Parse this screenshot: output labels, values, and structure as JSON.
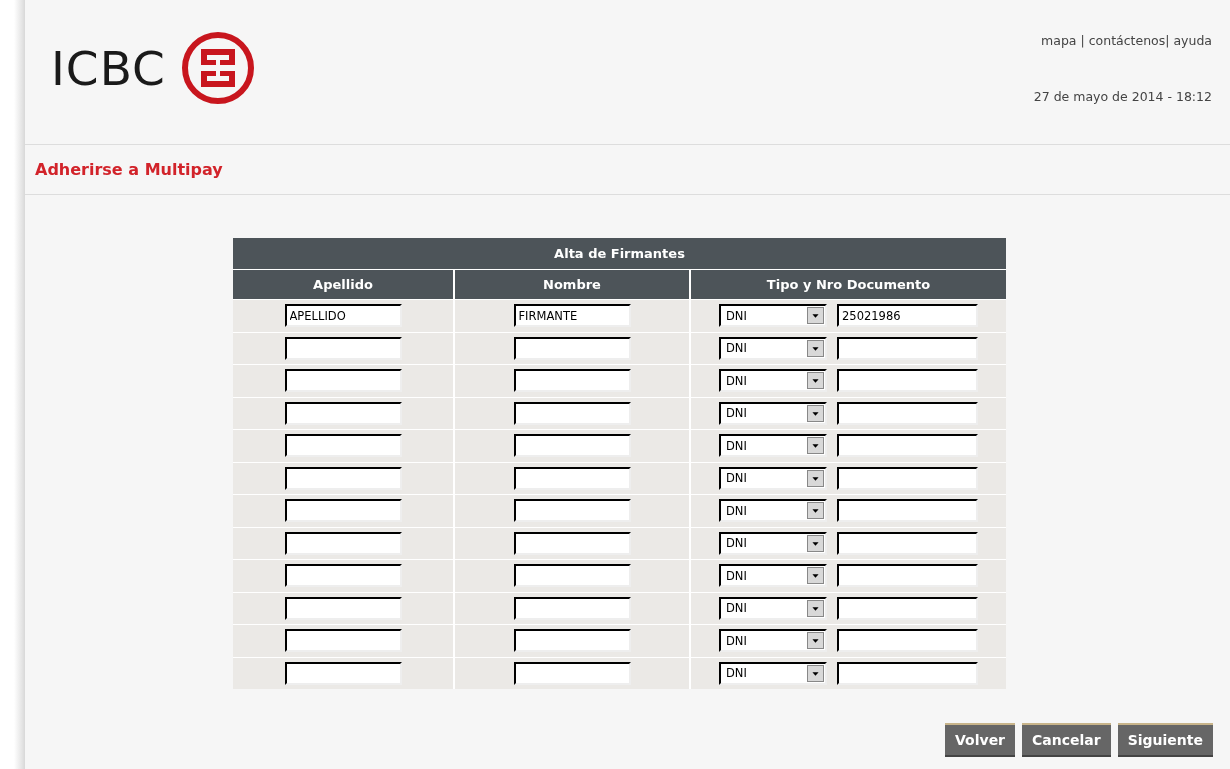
{
  "header": {
    "logo_text": "ICBC",
    "links_text": "mapa | contáctenos| ayuda",
    "datetime": "27 de mayo de 2014 - 18:12"
  },
  "page_title": "Adherirse a Multipay",
  "table": {
    "title": "Alta de Firmantes",
    "columns": [
      "Apellido",
      "Nombre",
      "Tipo y Nro Documento"
    ],
    "rows": [
      {
        "apellido": "APELLIDO",
        "nombre": "FIRMANTE",
        "doc_type": "DNI",
        "doc_number": "25021986"
      },
      {
        "doc_type": "DNI"
      },
      {
        "doc_type": "DNI"
      },
      {
        "doc_type": "DNI"
      },
      {
        "doc_type": "DNI"
      },
      {
        "doc_type": "DNI"
      },
      {
        "doc_type": "DNI"
      },
      {
        "doc_type": "DNI"
      },
      {
        "doc_type": "DNI"
      },
      {
        "doc_type": "DNI"
      },
      {
        "doc_type": "DNI"
      },
      {
        "doc_type": "DNI"
      }
    ]
  },
  "buttons": [
    "Volver",
    "Cancelar",
    "Siguiente"
  ]
}
